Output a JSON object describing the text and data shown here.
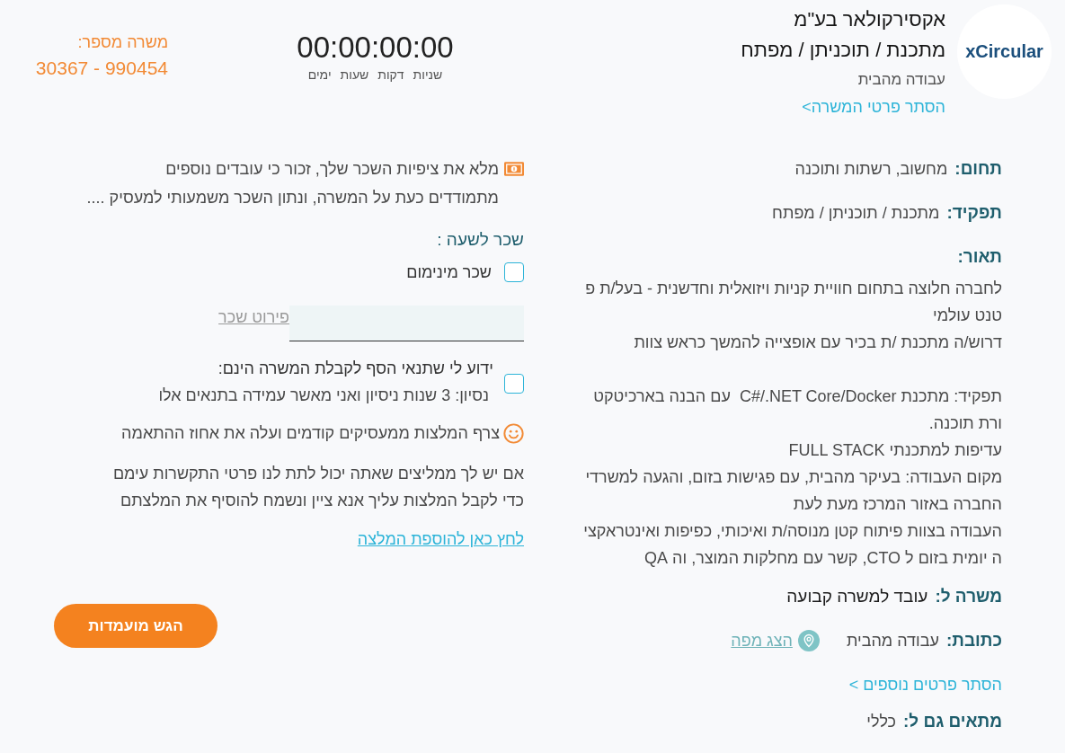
{
  "header": {
    "logo_text": "xCircular",
    "company_name": "אקסירקולאר בע\"מ",
    "job_title": "מתכנת / תוכניתן / מפתח",
    "work_type": "עבודה מהבית",
    "hide_job_details_link": "הסתר פרטי המשרה>"
  },
  "timer": {
    "value": "00:00:00:00",
    "units": [
      "שניות",
      "דקות",
      "שעות",
      "ימים"
    ]
  },
  "job_number": {
    "label": "משרה מספר:",
    "value": "30367 - 990454"
  },
  "job_details": {
    "fields": [
      {
        "label": "תחום:",
        "value": "מחשוב, רשתות ותוכנה"
      },
      {
        "label": "תפקיד:",
        "value": "מתכנת / תוכניתן / מפתח"
      }
    ],
    "description": {
      "label": "תאור:",
      "paragraphs": [
        [
          "לחברה חלוצה בתחום חוויית קניות ויזואלית וחדשנית - בעל/ת פ",
          "טנט עולמי",
          "דרוש/ה מתכנת /ת בכיר עם אופצייה להמשך כראש צוות"
        ],
        [
          "תפקיד: מתכנת C#/.NET Core/Docker  עם הבנה בארכיטקט",
          "ורת תוכנה.",
          "עדיפות למתכנתי FULL STACK",
          "מקום העבודה: בעיקר מהבית, עם פגישות בזום, והגעה למשרדי",
          "החברה באזור המרכז מעת לעת",
          "העבודה בצוות פיתוח קטן מנוסה/ת ואיכותי, כפיפות ואינטראקצי",
          "ה יומית בזום ל CTO, קשר עם מחלקות המוצר, וה QA"
        ]
      ]
    },
    "employment": {
      "label": "משרה ל:",
      "value": "עובד למשרה קבועה"
    },
    "address": {
      "label": "כתובת:",
      "value": "עבודה מהבית",
      "map_link": "הצג מפה"
    },
    "hide_more_link": "הסתר פרטים נוספים >",
    "suitable_for": {
      "label": "מתאים גם ל:",
      "value": "כללי"
    }
  },
  "application": {
    "salary_note": [
      "מלא את ציפיות השכר שלך, זכור כי עובדים נוספים",
      "מתמודדים כעת על המשרה, ונתון השכר משמעותי למעסיק ...."
    ],
    "hourly_wage_label": "שכר לשעה :",
    "minimum_wage": {
      "label": "שכר מינימום",
      "checked": false
    },
    "salary_details": {
      "label": "פירוט שכר"
    },
    "requirements": {
      "title": "ידוע לי שתנאי הסף לקבלת המשרה הינם:",
      "condition": "נסיון: 3 שנות ניסיון ואני מאשר עמידה בתנאים אלו",
      "checked": false
    },
    "recommendations_tip": "צרף המלצות ממעסיקים קודמים ועלה את אחוז ההתאמה",
    "recommenders_text": [
      "אם יש לך ממליצים שאתה יכול לתת לנו פרטי התקשרות עימם",
      "כדי לקבל המלצות עליך אנא ציין ונשמח להוסיף את המלצתם"
    ],
    "add_recommendation_link": "לחץ כאן להוספת המלצה",
    "submit_button": "הגש מועמדות"
  }
}
